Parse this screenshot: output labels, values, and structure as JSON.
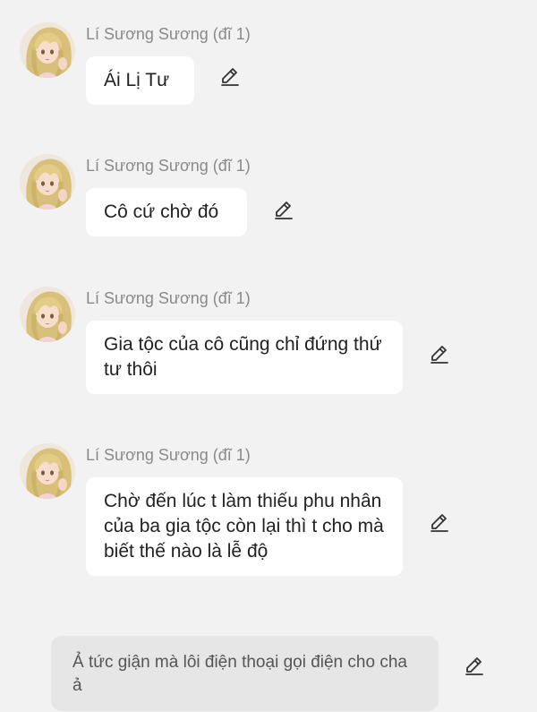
{
  "messages": [
    {
      "sender": "Lí Sương Sương (đĩ 1)",
      "text": "Ái Lị Tư"
    },
    {
      "sender": "Lí Sương Sương (đĩ 1)",
      "text": "Cô cứ chờ đó"
    },
    {
      "sender": "Lí Sương Sương (đĩ 1)",
      "text": "Gia tộc của cô cũng chỉ đứng thứ tư thôi"
    },
    {
      "sender": "Lí Sương Sương (đĩ 1)",
      "text": "Chờ đến lúc t làm thiếu phu nhân của ba gia tộc còn lại thì t cho mà biết thế nào là lễ độ"
    }
  ],
  "narration": {
    "text": "Ả tức giận mà lôi điện thoại gọi điện cho cha ả"
  },
  "icons": {
    "avatar": "anime-girl-avatar",
    "edit": "pencil-edit-icon"
  },
  "colors": {
    "background": "#f2f2f2",
    "bubble": "#ffffff",
    "narration_bubble": "#e6e6e6",
    "sender_text": "#8a8a8a"
  }
}
